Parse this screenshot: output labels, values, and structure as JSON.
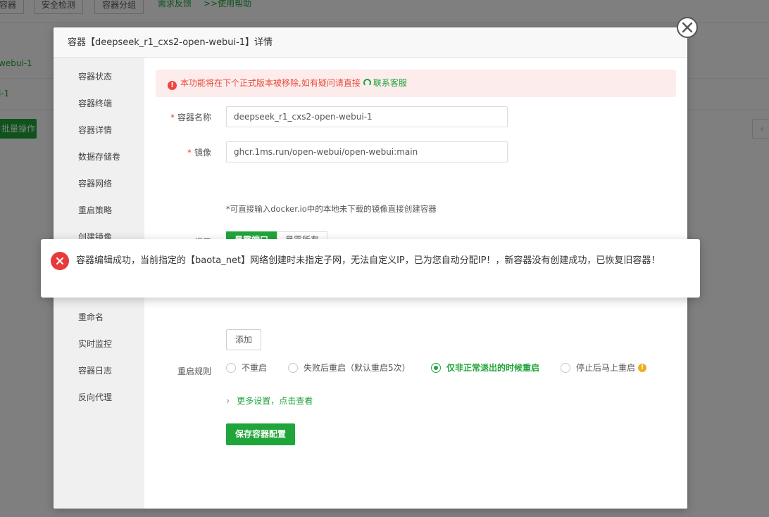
{
  "background": {
    "toolbar_buttons": [
      "容器",
      "安全检测",
      "容器分组"
    ],
    "toolbar_links": [
      "需求反馈",
      ">>使用帮助"
    ],
    "rows": [
      "webui-1",
      "i-1"
    ],
    "batch_button": "批量操作",
    "pager_prev": "‹"
  },
  "modal": {
    "title": "容器【deepseek_r1_cxs2-open-webui-1】详情",
    "close_icon": "close-icon",
    "sidebar": [
      "容器状态",
      "容器终端",
      "容器详情",
      "数据存储卷",
      "容器网络",
      "重启策略",
      "创建镜像",
      "",
      "",
      "重命名",
      "实时监控",
      "容器日志",
      "反向代理"
    ],
    "warning": {
      "text": "本功能将在下个正式版本被移除,如有疑问请直接",
      "link": "联系客服"
    },
    "form": {
      "name_label": "容器名称",
      "name_value": "deepseek_r1_cxs2-open-webui-1",
      "image_label": "镜像",
      "image_value": "ghcr.1ms.run/open-webui/open-webui:main",
      "hint": "*可直接输入docker.io中的本地未下载的镜像直接创建容器",
      "port_label": "端口",
      "port_tabs": [
        "暴露端口",
        "暴露所有"
      ],
      "add_button": "添加",
      "restart_label": "重启规则",
      "restart_options": [
        "不重启",
        "失败后重启（默认重启5次）",
        "仅非正常退出的时候重启",
        "停止后马上重启"
      ],
      "restart_selected": "仅非正常退出的时候重启",
      "more_settings": "更多设置，点击查看",
      "save_button": "保存容器配置"
    }
  },
  "toast": {
    "type": "error",
    "message": "容器编辑成功，当前指定的【baota_net】网络创建时未指定子网，无法自定义IP，已为您自动分配IP！，新容器没有创建成功，已恢复旧容器！"
  },
  "colors": {
    "accent": "#20a53a",
    "error": "#e63b3b",
    "warning_bg": "#fdecec"
  }
}
